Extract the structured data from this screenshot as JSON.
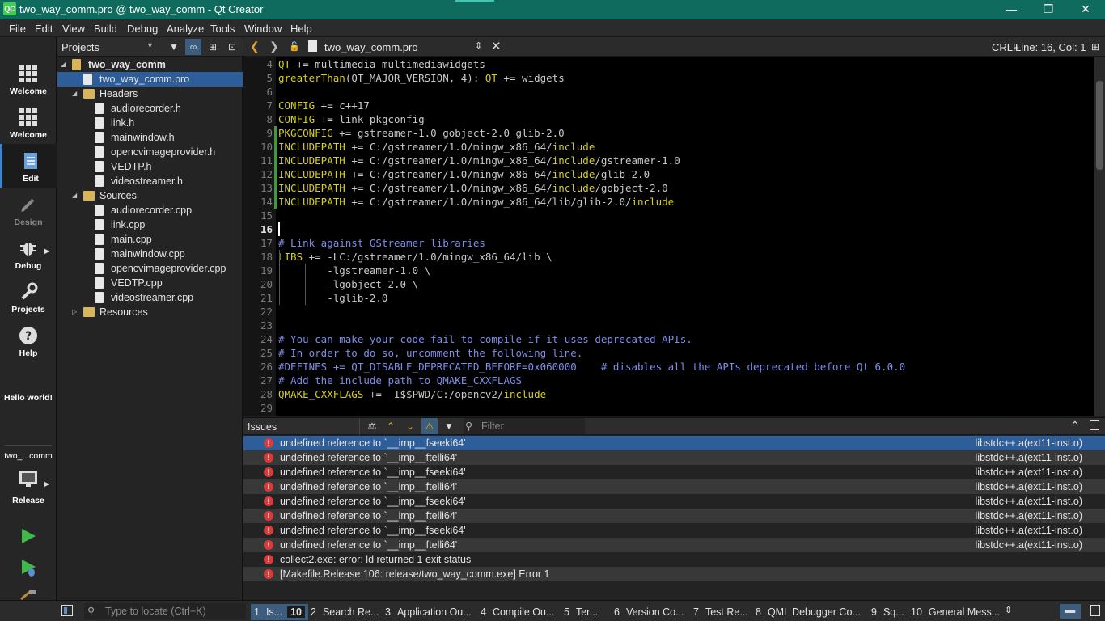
{
  "window": {
    "title": "two_way_comm.pro @ two_way_comm - Qt Creator",
    "app_icon_text": "QC",
    "minimize_icon": "minimize-icon",
    "maximize_icon": "restore-icon",
    "close_icon": "close-icon"
  },
  "menu": [
    "File",
    "Edit",
    "View",
    "Build",
    "Debug",
    "Analyze",
    "Tools",
    "Window",
    "Help"
  ],
  "modes": [
    {
      "label": "Welcome",
      "icon": "grid-icon"
    },
    {
      "label": "Welcome",
      "icon": "grid-icon"
    },
    {
      "label": "Edit",
      "icon": "document-icon"
    },
    {
      "label": "Design",
      "icon": "pen-icon"
    },
    {
      "label": "Debug",
      "icon": "bug-icon"
    },
    {
      "label": "Projects",
      "icon": "wrench-icon"
    },
    {
      "label": "Help",
      "icon": "help-icon"
    }
  ],
  "hello": "Hello world!",
  "kit": {
    "project": "two_...comm",
    "config": "Release"
  },
  "projects_panel": {
    "title": "Projects",
    "tree": [
      {
        "label": "two_way_comm",
        "level": 0,
        "kind": "project",
        "expanded": true,
        "bold": true
      },
      {
        "label": "two_way_comm.pro",
        "level": 1,
        "kind": "pro",
        "selected": true
      },
      {
        "label": "Headers",
        "level": 1,
        "kind": "folder",
        "expanded": true
      },
      {
        "label": "audiorecorder.h",
        "level": 2,
        "kind": "file"
      },
      {
        "label": "link.h",
        "level": 2,
        "kind": "file"
      },
      {
        "label": "mainwindow.h",
        "level": 2,
        "kind": "file"
      },
      {
        "label": "opencvimageprovider.h",
        "level": 2,
        "kind": "file"
      },
      {
        "label": "VEDTP.h",
        "level": 2,
        "kind": "file"
      },
      {
        "label": "videostreamer.h",
        "level": 2,
        "kind": "file"
      },
      {
        "label": "Sources",
        "level": 1,
        "kind": "folder",
        "expanded": true
      },
      {
        "label": "audiorecorder.cpp",
        "level": 2,
        "kind": "file"
      },
      {
        "label": "link.cpp",
        "level": 2,
        "kind": "file"
      },
      {
        "label": "main.cpp",
        "level": 2,
        "kind": "file"
      },
      {
        "label": "mainwindow.cpp",
        "level": 2,
        "kind": "file"
      },
      {
        "label": "opencvimageprovider.cpp",
        "level": 2,
        "kind": "file"
      },
      {
        "label": "VEDTP.cpp",
        "level": 2,
        "kind": "file"
      },
      {
        "label": "videostreamer.cpp",
        "level": 2,
        "kind": "file"
      },
      {
        "label": "Resources",
        "level": 1,
        "kind": "folder",
        "expanded": false
      }
    ]
  },
  "editor": {
    "file_name": "two_way_comm.pro",
    "line_ending": "CRLF",
    "position": "Line: 16, Col: 1",
    "current_line": 16,
    "lines": [
      {
        "n": 4,
        "changed": false,
        "parts": [
          [
            "kw",
            "QT"
          ],
          [
            "tx",
            " += multimedia multimediawidgets"
          ]
        ]
      },
      {
        "n": 5,
        "changed": false,
        "parts": [
          [
            "fn",
            "greaterThan"
          ],
          [
            "tx",
            "(QT_MAJOR_VERSION, 4): "
          ],
          [
            "kw",
            "QT"
          ],
          [
            "tx",
            " += widgets"
          ]
        ]
      },
      {
        "n": 6,
        "changed": false,
        "parts": []
      },
      {
        "n": 7,
        "changed": false,
        "parts": [
          [
            "kw",
            "CONFIG"
          ],
          [
            "tx",
            " += c++17"
          ]
        ]
      },
      {
        "n": 8,
        "changed": false,
        "parts": [
          [
            "kw",
            "CONFIG"
          ],
          [
            "tx",
            " += link_pkgconfig"
          ]
        ]
      },
      {
        "n": 9,
        "changed": true,
        "parts": [
          [
            "kw",
            "PKGCONFIG"
          ],
          [
            "tx",
            " += gstreamer-1.0 gobject-2.0 glib-2.0"
          ]
        ]
      },
      {
        "n": 10,
        "changed": true,
        "parts": [
          [
            "kw",
            "INCLUDEPATH"
          ],
          [
            "tx",
            " += C:/gstreamer/1.0/mingw_x86_64/"
          ],
          [
            "kw",
            "include"
          ]
        ]
      },
      {
        "n": 11,
        "changed": true,
        "parts": [
          [
            "kw",
            "INCLUDEPATH"
          ],
          [
            "tx",
            " += C:/gstreamer/1.0/mingw_x86_64/"
          ],
          [
            "kw",
            "include"
          ],
          [
            "tx",
            "/gstreamer-1.0"
          ]
        ]
      },
      {
        "n": 12,
        "changed": true,
        "parts": [
          [
            "kw",
            "INCLUDEPATH"
          ],
          [
            "tx",
            " += C:/gstreamer/1.0/mingw_x86_64/"
          ],
          [
            "kw",
            "include"
          ],
          [
            "tx",
            "/glib-2.0"
          ]
        ]
      },
      {
        "n": 13,
        "changed": true,
        "parts": [
          [
            "kw",
            "INCLUDEPATH"
          ],
          [
            "tx",
            " += C:/gstreamer/1.0/mingw_x86_64/"
          ],
          [
            "kw",
            "include"
          ],
          [
            "tx",
            "/gobject-2.0"
          ]
        ]
      },
      {
        "n": 14,
        "changed": true,
        "parts": [
          [
            "kw",
            "INCLUDEPATH"
          ],
          [
            "tx",
            " += C:/gstreamer/1.0/mingw_x86_64/lib/glib-2.0/"
          ],
          [
            "kw",
            "include"
          ]
        ]
      },
      {
        "n": 15,
        "changed": false,
        "parts": []
      },
      {
        "n": 16,
        "changed": false,
        "parts": []
      },
      {
        "n": 17,
        "changed": false,
        "parts": [
          [
            "cm",
            "# Link against GStreamer libraries"
          ]
        ]
      },
      {
        "n": 18,
        "changed": false,
        "parts": [
          [
            "kw",
            "LIBS"
          ],
          [
            "tx",
            " += -LC:/gstreamer/1.0/mingw_x86_64/lib \\"
          ]
        ]
      },
      {
        "n": 19,
        "changed": false,
        "parts": [
          [
            "tx",
            "        -lgstreamer-1.0 \\"
          ]
        ]
      },
      {
        "n": 20,
        "changed": false,
        "parts": [
          [
            "tx",
            "        -lgobject-2.0 \\"
          ]
        ]
      },
      {
        "n": 21,
        "changed": false,
        "parts": [
          [
            "tx",
            "        -lglib-2.0"
          ]
        ]
      },
      {
        "n": 22,
        "changed": false,
        "parts": []
      },
      {
        "n": 23,
        "changed": false,
        "parts": []
      },
      {
        "n": 24,
        "changed": false,
        "parts": [
          [
            "cm",
            "# You can make your code fail to compile if it uses deprecated APIs."
          ]
        ]
      },
      {
        "n": 25,
        "changed": false,
        "parts": [
          [
            "cm",
            "# In order to do so, uncomment the following line."
          ]
        ]
      },
      {
        "n": 26,
        "changed": false,
        "parts": [
          [
            "cm",
            "#DEFINES += QT_DISABLE_DEPRECATED_BEFORE=0x060000    # disables all the APIs deprecated before Qt 6.0.0"
          ]
        ]
      },
      {
        "n": 27,
        "changed": false,
        "parts": [
          [
            "cm",
            "# Add the include path to QMAKE_CXXFLAGS"
          ]
        ]
      },
      {
        "n": 28,
        "changed": false,
        "parts": [
          [
            "kw",
            "QMAKE_CXXFLAGS"
          ],
          [
            "tx",
            " += -I$$PWD/C:/opencv2/"
          ],
          [
            "kw",
            "include"
          ]
        ]
      },
      {
        "n": 29,
        "changed": false,
        "parts": []
      }
    ]
  },
  "issues_panel": {
    "title": "Issues",
    "filter_placeholder": "Filter",
    "rows": [
      {
        "desc": "undefined reference to `__imp__fseeki64'",
        "file": "libstdc++.a(ext11-inst.o)",
        "selected": true
      },
      {
        "desc": "undefined reference to `__imp__ftelli64'",
        "file": "libstdc++.a(ext11-inst.o)"
      },
      {
        "desc": "undefined reference to `__imp__fseeki64'",
        "file": "libstdc++.a(ext11-inst.o)"
      },
      {
        "desc": "undefined reference to `__imp__ftelli64'",
        "file": "libstdc++.a(ext11-inst.o)"
      },
      {
        "desc": "undefined reference to `__imp__fseeki64'",
        "file": "libstdc++.a(ext11-inst.o)"
      },
      {
        "desc": "undefined reference to `__imp__ftelli64'",
        "file": "libstdc++.a(ext11-inst.o)"
      },
      {
        "desc": "undefined reference to `__imp__fseeki64'",
        "file": "libstdc++.a(ext11-inst.o)"
      },
      {
        "desc": "undefined reference to `__imp__ftelli64'",
        "file": "libstdc++.a(ext11-inst.o)"
      },
      {
        "desc": "collect2.exe: error: ld returned 1 exit status",
        "file": ""
      },
      {
        "desc": "[Makefile.Release:106: release/two_way_comm.exe] Error 1",
        "file": ""
      }
    ]
  },
  "statusbar": {
    "locate_placeholder": "Type to locate (Ctrl+K)",
    "tabs": [
      {
        "num": "1",
        "label": "Is...",
        "badge": "10",
        "active": true
      },
      {
        "num": "2",
        "label": "Search Re..."
      },
      {
        "num": "3",
        "label": "Application Ou..."
      },
      {
        "num": "4",
        "label": "Compile Ou..."
      },
      {
        "num": "5",
        "label": "Ter..."
      },
      {
        "num": "6",
        "label": "Version Co..."
      },
      {
        "num": "7",
        "label": "Test Re..."
      },
      {
        "num": "8",
        "label": "QML Debugger Co..."
      },
      {
        "num": "9",
        "label": "Sq..."
      },
      {
        "num": "10",
        "label": "General Mess..."
      }
    ]
  },
  "colors": {
    "titlebar": "#0e6b5e",
    "selection": "#2d5e9a",
    "keyword": "#d6cf1b",
    "comment": "#7d8de8",
    "error": "#d83b3b"
  }
}
